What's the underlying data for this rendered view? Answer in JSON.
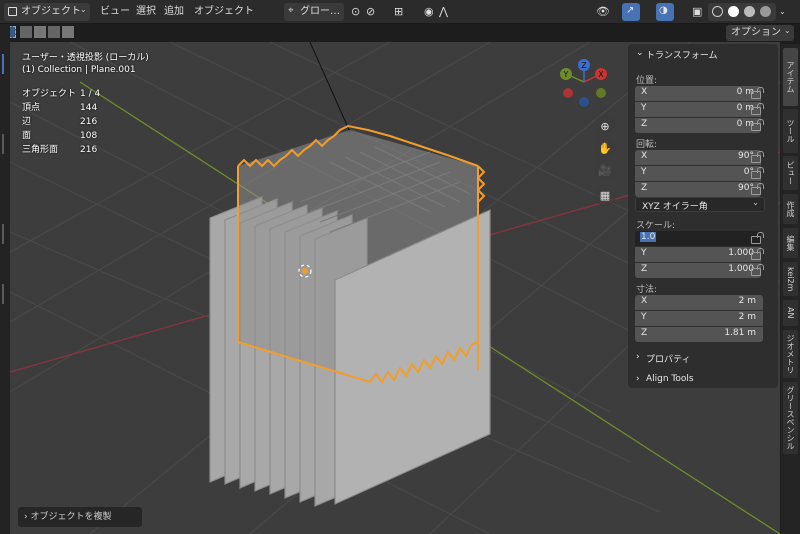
{
  "header": {
    "mode": "オブジェクト",
    "menus": [
      "ビュー",
      "選択",
      "追加",
      "オブジェクト"
    ],
    "orientation": "グロー…",
    "options": "オプション"
  },
  "overlay": {
    "view_name": "ユーザー・透視投影 (ローカル)",
    "collection": "(1) Collection | Plane.001",
    "stats": [
      {
        "label": "オブジェクト",
        "value": "1 / 4"
      },
      {
        "label": "頂点",
        "value": "144"
      },
      {
        "label": "辺",
        "value": "216"
      },
      {
        "label": "面",
        "value": "108"
      },
      {
        "label": "三角形面",
        "value": "216"
      }
    ]
  },
  "gizmo": {
    "x": "X",
    "y": "Y",
    "z": "Z"
  },
  "npanel": {
    "transform_title": "トランスフォーム",
    "location_label": "位置:",
    "location": [
      {
        "axis": "X",
        "value": "0 m"
      },
      {
        "axis": "Y",
        "value": "0 m"
      },
      {
        "axis": "Z",
        "value": "0 m"
      }
    ],
    "rotation_label": "回転:",
    "rotation": [
      {
        "axis": "X",
        "value": "90°"
      },
      {
        "axis": "Y",
        "value": "0°"
      },
      {
        "axis": "Z",
        "value": "90°"
      }
    ],
    "rotation_mode": "XYZ オイラー角",
    "scale_label": "スケール:",
    "scale": [
      {
        "axis": "X",
        "value": "1.0"
      },
      {
        "axis": "Y",
        "value": "1.000"
      },
      {
        "axis": "Z",
        "value": "1.000"
      }
    ],
    "dimensions_label": "寸法:",
    "dimensions": [
      {
        "axis": "X",
        "value": "2 m"
      },
      {
        "axis": "Y",
        "value": "2 m"
      },
      {
        "axis": "Z",
        "value": "1.81 m"
      }
    ],
    "properties": "プロパティ",
    "align_tools": "Align Tools"
  },
  "tabs": [
    "アイテム",
    "ツール",
    "ビュー",
    "作成",
    "編集",
    "kei2m",
    "AN",
    "ジオメトリ",
    "グリースペンシル"
  ],
  "redo_panel": "オブジェクトを複製",
  "colors": {
    "selection": "#f29d2c",
    "accent": "#4772b3",
    "x_axis": "#8a3340",
    "y_axis": "#6f8d2a"
  }
}
